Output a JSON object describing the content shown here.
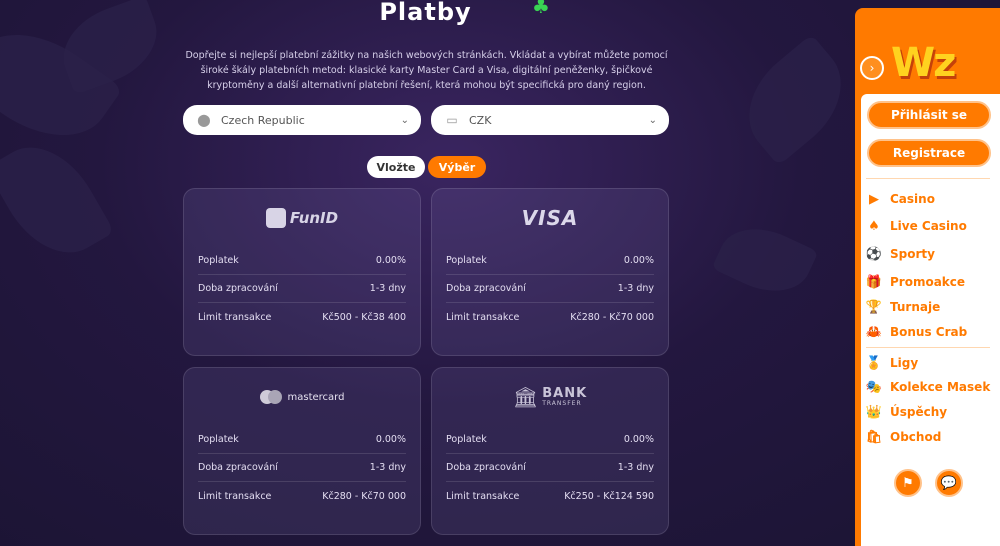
{
  "page": {
    "title": "Platby",
    "description": "Dopřejte si nejlepší platební zážitky na našich webových stránkách. Vkládat a vybírat můžete pomocí široké škály platebních metod: klasické karty Master Card a Visa, digitální peněženky, špičkové kryptoměny a další alternativní platební řešení, která mohou být specifická pro daný region."
  },
  "filters": {
    "country": "Czech Republic",
    "currency": "CZK"
  },
  "toggle": {
    "deposit": "Vložte",
    "withdraw": "Výběr"
  },
  "cards": [
    {
      "logo": "FunID",
      "rows": [
        {
          "label": "Poplatek",
          "value": "0.00%"
        },
        {
          "label": "Doba zpracování",
          "value": "1-3 dny"
        },
        {
          "label": "Limit transakce",
          "value": "Kč500 - Kč38 400"
        }
      ]
    },
    {
      "logo": "VISA",
      "rows": [
        {
          "label": "Poplatek",
          "value": "0.00%"
        },
        {
          "label": "Doba zpracování",
          "value": "1-3 dny"
        },
        {
          "label": "Limit transakce",
          "value": "Kč280 - Kč70 000"
        }
      ]
    },
    {
      "logo": "mastercard",
      "rows": [
        {
          "label": "Poplatek",
          "value": "0.00%"
        },
        {
          "label": "Doba zpracování",
          "value": "1-3 dny"
        },
        {
          "label": "Limit transakce",
          "value": "Kč280 - Kč70 000"
        }
      ]
    },
    {
      "logo": "BANK",
      "logo_sub": "TRANSFER",
      "rows": [
        {
          "label": "Poplatek",
          "value": "0.00%"
        },
        {
          "label": "Doba zpracování",
          "value": "1-3 dny"
        },
        {
          "label": "Limit transakce",
          "value": "Kč250 - Kč124 590"
        }
      ]
    }
  ],
  "sidebar": {
    "brand": "Wz",
    "login": "Přihlásit se",
    "register": "Registrace",
    "nav": [
      {
        "label": "Casino",
        "icon": "casino-icon"
      },
      {
        "label": "Live Casino",
        "icon": "live-casino-icon"
      },
      {
        "label": "Sporty",
        "icon": "sports-icon"
      },
      {
        "label": "Promoakce",
        "icon": "gift-icon"
      },
      {
        "label": "Turnaje",
        "icon": "trophy-icon"
      },
      {
        "label": "Bonus Crab",
        "icon": "crab-icon"
      },
      {
        "label": "Ligy",
        "icon": "league-icon"
      },
      {
        "label": "Kolekce Masek",
        "icon": "mask-icon"
      },
      {
        "label": "Úspěchy",
        "icon": "crown-icon"
      },
      {
        "label": "Obchod",
        "icon": "shop-icon"
      }
    ]
  },
  "colors": {
    "accent": "#ff7a00",
    "background": "#23173f"
  }
}
